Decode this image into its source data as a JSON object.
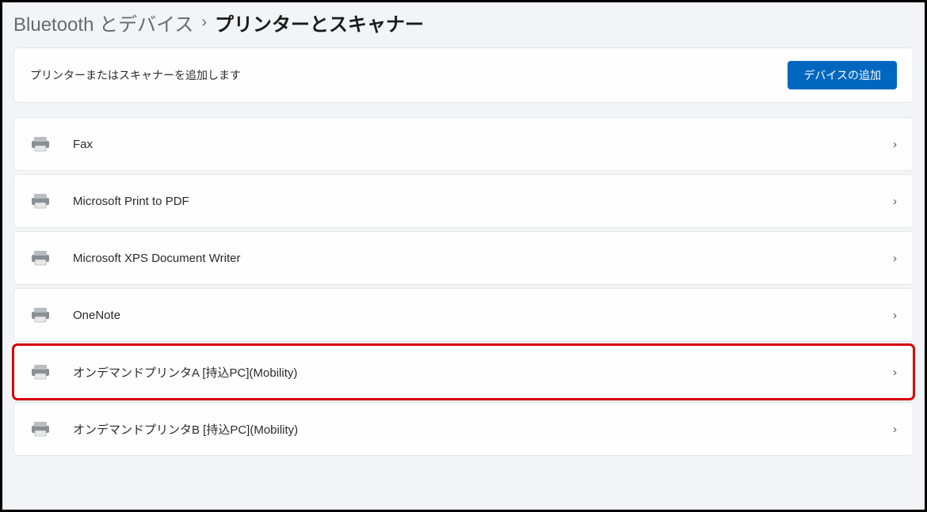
{
  "breadcrumb": {
    "parent": "Bluetooth とデバイス",
    "separator": "›",
    "current": "プリンターとスキャナー"
  },
  "addBar": {
    "label": "プリンターまたはスキャナーを追加します",
    "buttonLabel": "デバイスの追加"
  },
  "devices": [
    {
      "name": "Fax",
      "highlighted": false
    },
    {
      "name": "Microsoft Print to PDF",
      "highlighted": false
    },
    {
      "name": "Microsoft XPS Document Writer",
      "highlighted": false
    },
    {
      "name": "OneNote",
      "highlighted": false
    },
    {
      "name": "オンデマンドプリンタA [持込PC](Mobility)",
      "highlighted": true
    },
    {
      "name": "オンデマンドプリンタB [持込PC](Mobility)",
      "highlighted": false
    }
  ]
}
